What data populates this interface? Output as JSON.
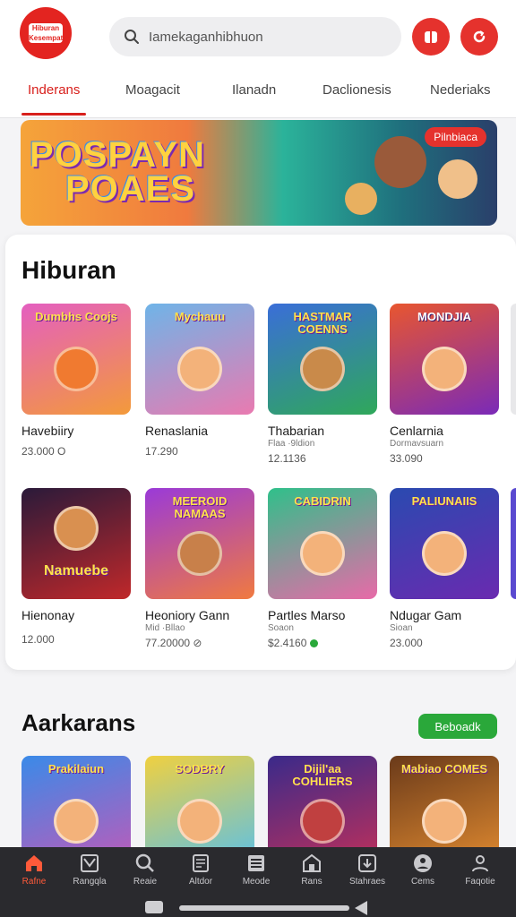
{
  "header": {
    "logo_text": "Hiburan Kesempatan",
    "search_placeholder": "Iamekaganhibhuon"
  },
  "tabs": [
    {
      "label": "Inderans",
      "active": true
    },
    {
      "label": "Moagacit",
      "active": false
    },
    {
      "label": "Ilanadn",
      "active": false
    },
    {
      "label": "Daclionesis",
      "active": false
    },
    {
      "label": "Nederiaks",
      "active": false
    }
  ],
  "banner": {
    "title_line1": "POSPAYN",
    "title_line2": "POAES",
    "badge": "Pilnbiaca"
  },
  "section1": {
    "title": "Hiburan",
    "row1": [
      {
        "thumb_label": "Dumbhs Coojs",
        "name": "Havebiiry",
        "sub": "",
        "count": "23.000 O"
      },
      {
        "thumb_label": "Mychauu",
        "name": "Renaslania",
        "sub": "",
        "count": "17.290"
      },
      {
        "thumb_label": "HASTMAR COENNS",
        "name": "Thabarian",
        "sub": "Flaa ·9ldion",
        "count": "12.1136"
      },
      {
        "thumb_label": "MONDJIA",
        "name": "Cenlarnia",
        "sub": "Dormavsuarn",
        "count": "33.090"
      }
    ],
    "row2": [
      {
        "thumb_label": "Namuebe",
        "name": "Hienonay",
        "sub": "",
        "count": "12.000"
      },
      {
        "thumb_label": "MEEROID NAMAAS",
        "name": "Heoniory Gann",
        "sub": "Mid ·Bllao",
        "count": "77.20000 ⊘"
      },
      {
        "thumb_label": "CABIDRIN",
        "name": "Partles Marso",
        "sub": "Soaon",
        "count": "$2.4160"
      },
      {
        "thumb_label": "PALIUNAIIS",
        "name": "Ndugar Gam",
        "sub": "Sioan",
        "count": "23.000"
      }
    ]
  },
  "section2": {
    "title": "Aarkarans",
    "see_all": "Beboadk",
    "row": [
      {
        "thumb_label": "Prakilaiun"
      },
      {
        "thumb_label": "SODBRY"
      },
      {
        "thumb_label": "Dijil'aa COHLIERS"
      },
      {
        "thumb_label": "Mabiao COMES"
      }
    ]
  },
  "bottom_nav": [
    {
      "label": "Rafne",
      "icon": "home-icon",
      "active": true
    },
    {
      "label": "Rangqla",
      "icon": "category-icon",
      "active": false
    },
    {
      "label": "Reaie",
      "icon": "search-icon",
      "active": false
    },
    {
      "label": "Altdor",
      "icon": "grid-icon",
      "active": false
    },
    {
      "label": "Meode",
      "icon": "list-icon",
      "active": false
    },
    {
      "label": "Rans",
      "icon": "store-icon",
      "active": false
    },
    {
      "label": "Stahraes",
      "icon": "download-icon",
      "active": false
    },
    {
      "label": "Cems",
      "icon": "games-icon",
      "active": false
    },
    {
      "label": "Faqotie",
      "icon": "profile-icon",
      "active": false
    }
  ],
  "colors": {
    "accent": "#d8201c",
    "nav_bg": "#2a2a2e",
    "green": "#2aa83a"
  }
}
